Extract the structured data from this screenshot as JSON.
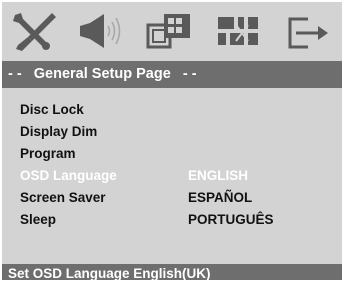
{
  "colors": {
    "screen_bg": "#d3d3d3",
    "bar_bg": "#6e6e6e",
    "text": "#111111",
    "highlight_text": "#ffffff",
    "icon": "#5a5a5a"
  },
  "icons": [
    {
      "name": "general-setup-icon",
      "selected": true
    },
    {
      "name": "audio-setup-icon",
      "selected": false
    },
    {
      "name": "video-setup-icon",
      "selected": false
    },
    {
      "name": "preference-setup-icon",
      "selected": false
    },
    {
      "name": "exit-icon",
      "selected": false
    }
  ],
  "header": {
    "title": "- -   General Setup Page   - -"
  },
  "menu": {
    "items": [
      {
        "label": "Disc Lock"
      },
      {
        "label": "Display Dim"
      },
      {
        "label": "Program"
      },
      {
        "label": "OSD Language",
        "selected": true
      },
      {
        "label": "Screen Saver"
      },
      {
        "label": "Sleep"
      }
    ]
  },
  "options": {
    "items": [
      {
        "label": "ENGLISH",
        "selected": true
      },
      {
        "label": "ESPAÑOL"
      },
      {
        "label": "PORTUGUÊS"
      }
    ]
  },
  "status": {
    "text": "Set OSD Language English(UK)"
  }
}
